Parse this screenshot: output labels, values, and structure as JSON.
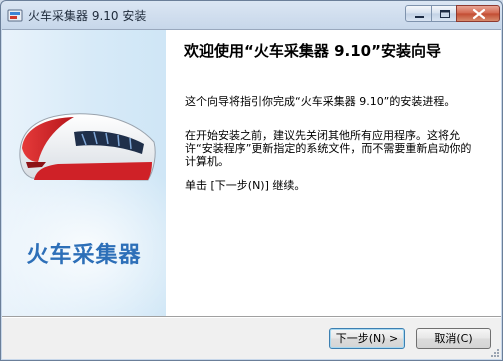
{
  "window": {
    "title": "火车采集器 9.10 安装"
  },
  "titlebar": {
    "minimize_icon": "minimize-icon",
    "maximize_icon": "maximize-icon",
    "close_icon": "close-icon"
  },
  "side_panel": {
    "brand": "火车采集器",
    "illustration": "train-logo"
  },
  "content": {
    "heading": "欢迎使用“火车采集器 9.10”安装向导",
    "para1": "这个向导将指引你完成“火车采集器 9.10”的安装进程。",
    "para2": "在开始安装之前，建议先关闭其他所有应用程序。这将允许“安装程序”更新指定的系统文件，而不需要重新启动你的计算机。",
    "para3": "单击 [下一步(N)] 继续。"
  },
  "buttons": {
    "next": "下一步(N) >",
    "cancel": "取消(C)"
  },
  "colors": {
    "brand_blue": "#2d6fb8",
    "train_red": "#d3272b"
  }
}
